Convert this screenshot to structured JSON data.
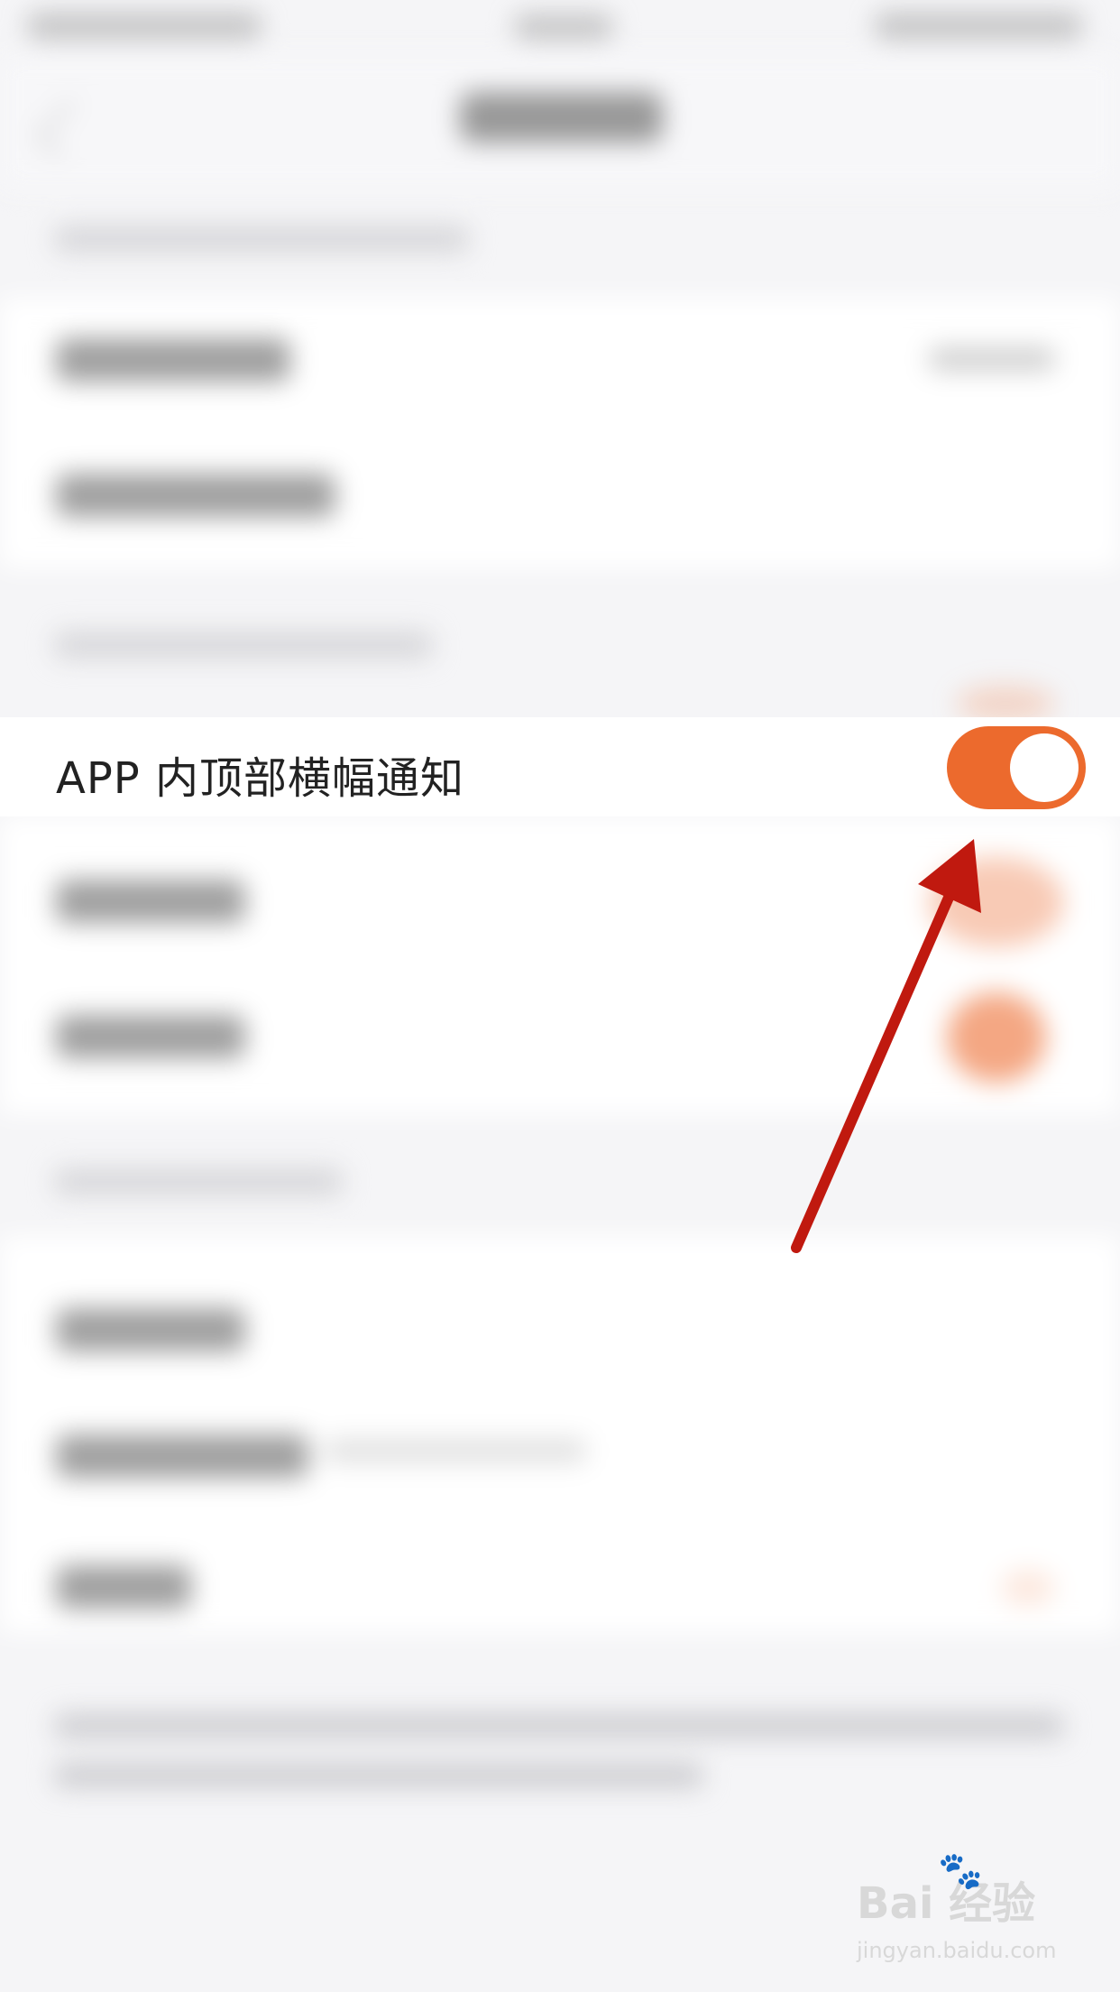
{
  "highlighted_setting": {
    "label": "APP 内顶部横幅通知",
    "toggle_on": true,
    "toggle_color": "#ec6a2d"
  },
  "annotation": {
    "arrow_color": "#c0190f"
  },
  "watermark": {
    "brand": "Bai  经验",
    "url": "jingyan.baidu.com"
  },
  "colors": {
    "background": "#f5f5f7",
    "row_background": "#ffffff",
    "accent": "#ec6a2d"
  }
}
